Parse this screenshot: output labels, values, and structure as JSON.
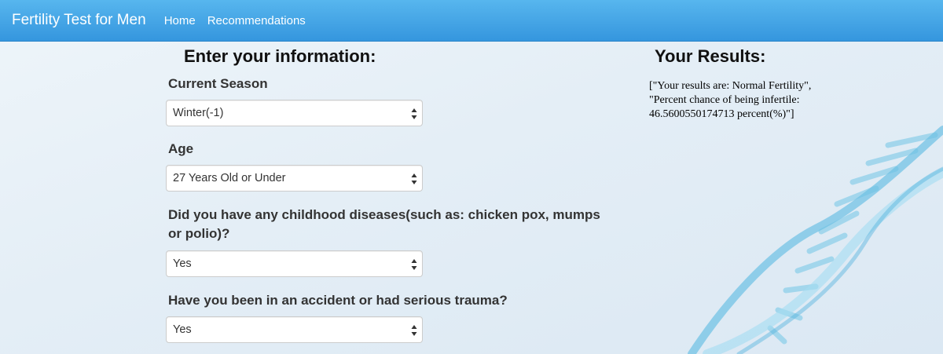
{
  "nav": {
    "brand": "Fertility Test for Men",
    "links": [
      "Home",
      "Recommendations"
    ]
  },
  "form": {
    "title": "Enter your information:",
    "fields": [
      {
        "label": "Current Season",
        "value": "Winter(-1)"
      },
      {
        "label": "Age",
        "value": "27 Years Old or Under"
      },
      {
        "label": "Did you have any childhood diseases(such as: chicken pox, mumps or polio)?",
        "value": "Yes"
      },
      {
        "label": "Have you been in an accident or had serious trauma?",
        "value": "Yes"
      }
    ]
  },
  "results": {
    "title": "Your Results:",
    "text": "[\"Your results are: Normal Fertility\", \"Percent chance of being infertile: 46.5600550174713 percent(%)\"]"
  },
  "colors": {
    "navbar": "#3fa3e6",
    "background": "#e4eef6",
    "dna": "#7cc4e3"
  },
  "icons": {
    "select_arrow": "up-down-chevron-icon",
    "background_art": "dna-helix-illustration"
  }
}
